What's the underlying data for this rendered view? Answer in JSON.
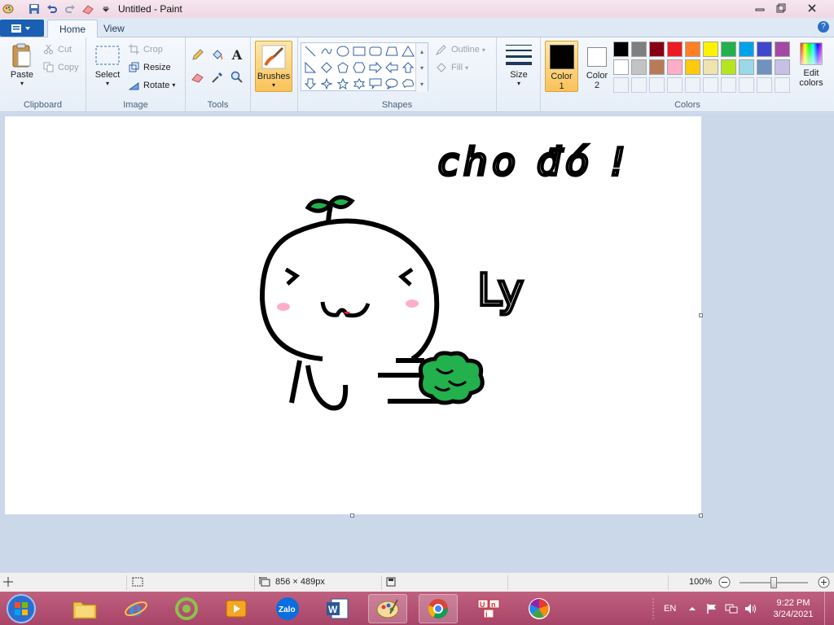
{
  "window": {
    "title": "Untitled - Paint"
  },
  "tabs": [
    {
      "label": "Home",
      "active": true
    },
    {
      "label": "View",
      "active": false
    }
  ],
  "ribbon": {
    "clipboard": {
      "group_label": "Clipboard",
      "paste": "Paste",
      "cut": "Cut",
      "copy": "Copy"
    },
    "image": {
      "group_label": "Image",
      "select": "Select",
      "crop": "Crop",
      "resize": "Resize",
      "rotate": "Rotate"
    },
    "tools": {
      "group_label": "Tools"
    },
    "brushes": {
      "label": "Brushes"
    },
    "shapes": {
      "group_label": "Shapes",
      "outline": "Outline",
      "fill": "Fill"
    },
    "size": {
      "label": "Size"
    },
    "colors": {
      "group_label": "Colors",
      "color1_label": "Color",
      "color1_num": "1",
      "color2_label": "Color",
      "color2_num": "2",
      "color1_value": "#000000",
      "color2_value": "#ffffff",
      "edit_label_1": "Edit",
      "edit_label_2": "colors",
      "palette_row1": [
        "#000000",
        "#7f7f7f",
        "#880015",
        "#ed1c24",
        "#ff7f27",
        "#fff200",
        "#22b14c",
        "#00a2e8",
        "#3f48cc",
        "#a349a4"
      ],
      "palette_row2": [
        "#ffffff",
        "#c3c3c3",
        "#b97a57",
        "#ffaec9",
        "#ffc90e",
        "#efe4b0",
        "#b5e61d",
        "#99d9ea",
        "#7092be",
        "#c8bfe7"
      ]
    }
  },
  "drawing": {
    "text_top": "cho đó !",
    "text_side": "Ly"
  },
  "status": {
    "dimensions": "856 × 489px",
    "zoom": "100%",
    "zoom_level": 0.5
  },
  "taskbar": {
    "apps": [
      "file-explorer",
      "internet-explorer",
      "coccoc",
      "media-player",
      "zalo",
      "word",
      "paint",
      "chrome",
      "unikey",
      "picasa"
    ],
    "language": "EN",
    "time": "9:22 PM",
    "date": "3/24/2021"
  }
}
